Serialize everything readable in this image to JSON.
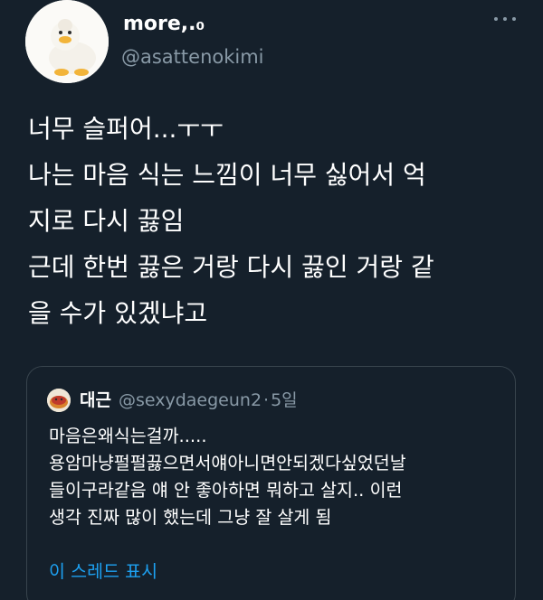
{
  "author": {
    "display_name": "more,.₀",
    "handle": "@asattenokimi"
  },
  "tweet": {
    "lines": [
      "너무 슬퍼어...ㅜㅜ",
      "나는 마음 식는 느낌이 너무 싫어서 억",
      "지로 다시 끓임",
      "근데 한번 끓은 거랑 다시 끓인 거랑 같",
      "을 수가 있겠냐고"
    ]
  },
  "quote": {
    "display_name": "대근",
    "handle": "@sexydaegeun2",
    "separator": "·",
    "time": "5일",
    "lines": [
      "마음은왜식는걸까.....",
      "용암마냥펄펄끓으면서얘아니면안되겠다싶었던날",
      "들이구라같음 얘 안 좋아하면 뭐하고 살지.. 이런",
      "생각 진짜 많이 했는데 그냥 잘 살게 됨"
    ],
    "show_thread_label": "이 스레드 표시"
  },
  "icons": {
    "more": "more-horizontal-icon",
    "avatar": "duck-plush-avatar",
    "quote_avatar": "bread-avatar"
  },
  "colors": {
    "background": "#15202b",
    "secondary_text": "#8899a6",
    "link": "#1da1f2",
    "border": "#38444d"
  }
}
